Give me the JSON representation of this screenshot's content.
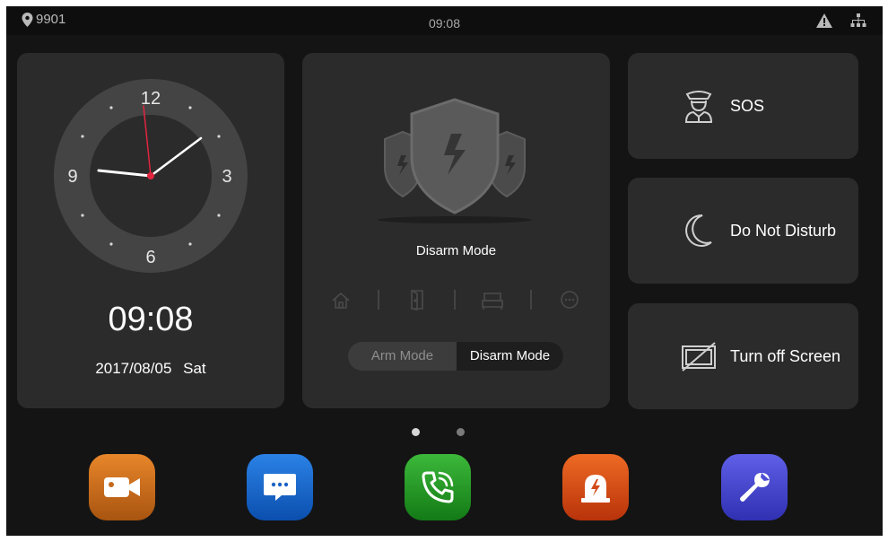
{
  "status_bar": {
    "device_number": "9901",
    "time": "09:08",
    "icons": [
      "location-pin-icon",
      "warning-icon",
      "network-icon"
    ]
  },
  "clock": {
    "face_numbers": {
      "n12": "12",
      "n3": "3",
      "n6": "6",
      "n9": "9"
    },
    "time": "09:08",
    "date": "2017/08/05",
    "weekday": "Sat"
  },
  "security": {
    "mode_label": "Disarm Mode",
    "zones": [
      "home-icon",
      "door-icon",
      "bed-icon",
      "more-icon"
    ],
    "toggle": {
      "arm_label": "Arm Mode",
      "disarm_label": "Disarm Mode",
      "selected": "Disarm Mode"
    }
  },
  "actions": {
    "sos": {
      "label": "SOS",
      "icon": "guard-icon"
    },
    "dnd": {
      "label": "Do Not Disturb",
      "icon": "moon-icon"
    },
    "screen_off": {
      "label": "Turn off Screen",
      "icon": "screen-off-icon"
    }
  },
  "pager": {
    "count": 2,
    "active_index": 0
  },
  "dock": [
    {
      "name": "camera",
      "icon": "video-camera-icon",
      "color_top": "#e8862a",
      "color_bottom": "#a85410"
    },
    {
      "name": "messages",
      "icon": "message-icon",
      "color_top": "#2b82e6",
      "color_bottom": "#0b4fae"
    },
    {
      "name": "call",
      "icon": "phone-icon",
      "color_top": "#3cb83a",
      "color_bottom": "#137a16"
    },
    {
      "name": "alarm",
      "icon": "alarm-icon",
      "color_top": "#ee6a24",
      "color_bottom": "#b8330a"
    },
    {
      "name": "settings",
      "icon": "wrench-icon",
      "color_top": "#5f5fe8",
      "color_bottom": "#3030b2"
    }
  ],
  "colors": {
    "background": "#141414",
    "card": "#2b2b2b",
    "second_hand": "#e0253f",
    "text": "#ffffff",
    "muted_text": "#8e8e8e"
  }
}
